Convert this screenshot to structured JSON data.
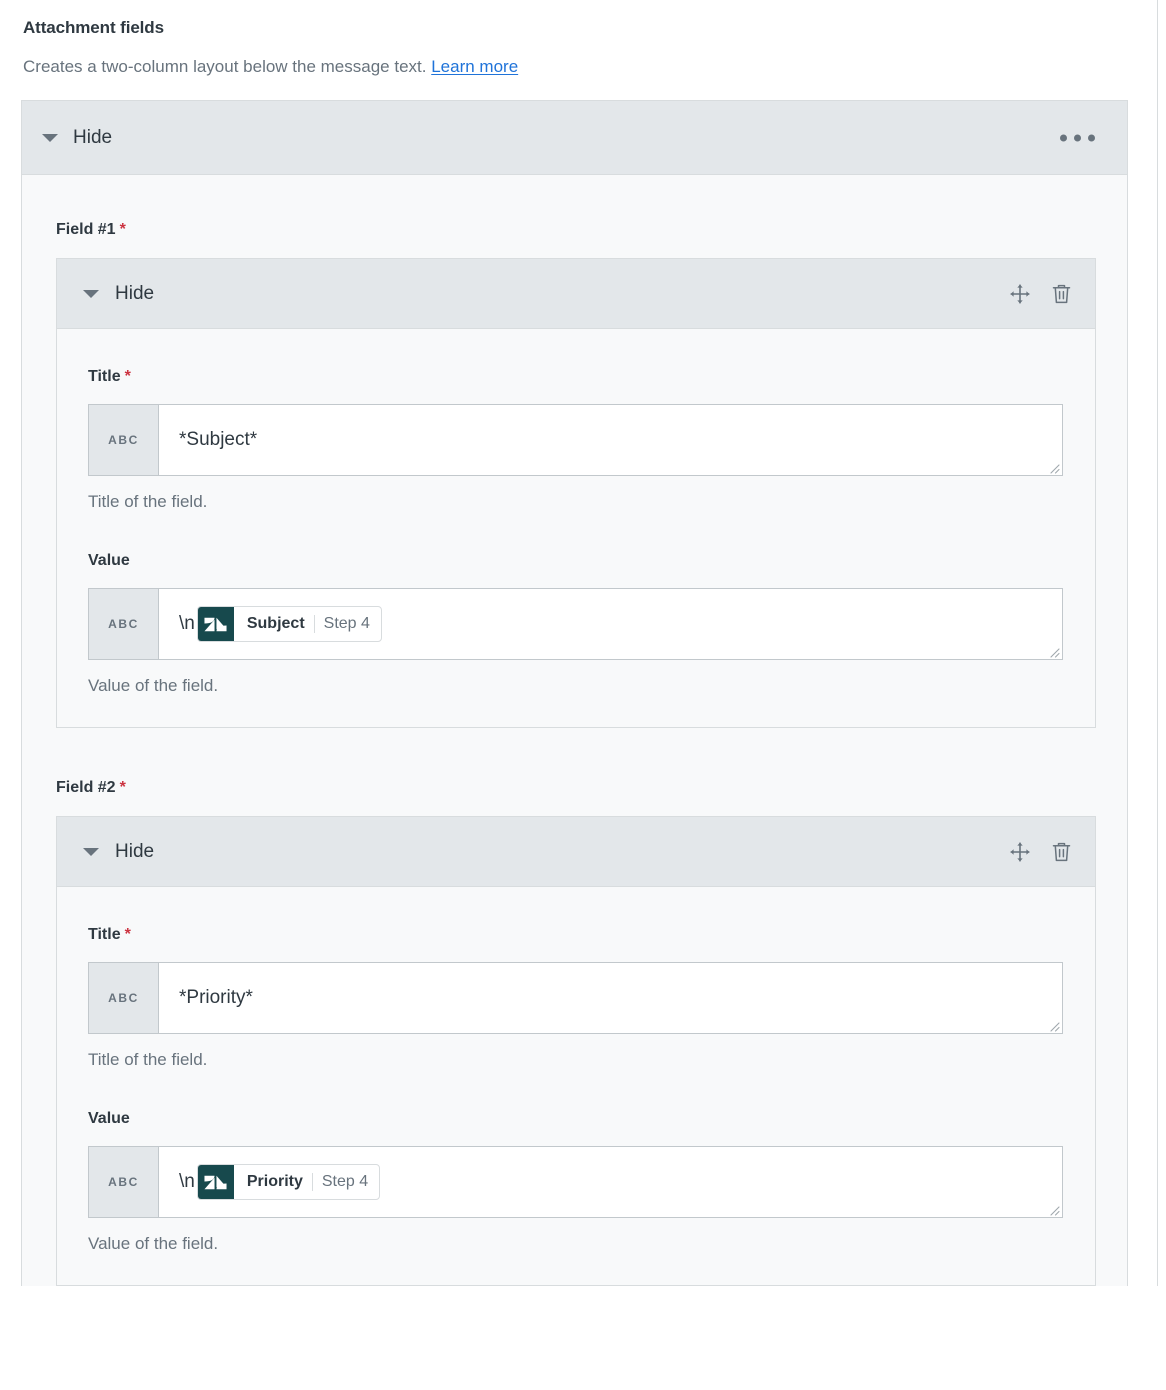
{
  "section": {
    "title": "Attachment fields",
    "description": "Creates a two-column layout below the message text.",
    "learn_more": "Learn more"
  },
  "panel": {
    "toggle_label": "Hide",
    "menu_icon": "kebab-menu-icon"
  },
  "fields": [
    {
      "group_label": "Field #1",
      "required_mark": "*",
      "toggle_label": "Hide",
      "title": {
        "label": "Title",
        "required_mark": "*",
        "prefix": "ABC",
        "value": "*Subject*",
        "hint": "Title of the field."
      },
      "value": {
        "label": "Value",
        "prefix": "ABC",
        "text_before": "\\n",
        "token": {
          "app": "zendesk-logo-icon",
          "name": "Subject",
          "step": "Step 4"
        },
        "hint": "Value of the field."
      }
    },
    {
      "group_label": "Field #2",
      "required_mark": "*",
      "toggle_label": "Hide",
      "title": {
        "label": "Title",
        "required_mark": "*",
        "prefix": "ABC",
        "value": "*Priority*",
        "hint": "Title of the field."
      },
      "value": {
        "label": "Value",
        "prefix": "ABC",
        "text_before": "\\n",
        "token": {
          "app": "zendesk-logo-icon",
          "name": "Priority",
          "step": "Step 4"
        },
        "hint": "Value of the field."
      }
    }
  ],
  "colors": {
    "accent_link": "#1f73d9",
    "required": "#cc3340",
    "header_bg": "#e3e7ea",
    "token_brand": "#17494d",
    "muted_text": "#68737d"
  }
}
